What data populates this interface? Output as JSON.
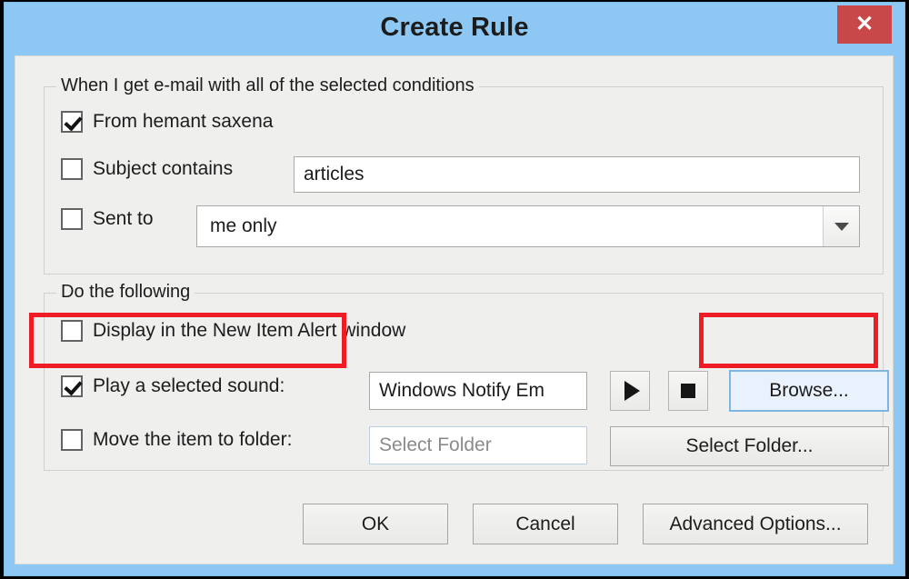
{
  "window": {
    "title": "Create Rule",
    "close_label": "✕",
    "close_icon": "close-icon"
  },
  "conditions": {
    "legend": "When I get e-mail with all of the selected conditions",
    "items": [
      {
        "label": "From hemant saxena",
        "checked": true
      },
      {
        "label": "Subject contains",
        "checked": false,
        "value": "articles"
      },
      {
        "label": "Sent to",
        "checked": false,
        "value": "me only"
      }
    ]
  },
  "actions": {
    "legend": "Do the following",
    "display_alert": {
      "label": "Display in the New Item Alert window",
      "checked": false
    },
    "play_sound": {
      "label": "Play a selected sound:",
      "checked": true,
      "sound_value": "Windows Notify Em",
      "play_icon": "play-icon",
      "stop_icon": "stop-icon",
      "browse_label": "Browse..."
    },
    "move_folder": {
      "label": "Move the item to folder:",
      "checked": false,
      "placeholder": "Select Folder",
      "button_label": "Select Folder..."
    }
  },
  "footer": {
    "ok_label": "OK",
    "cancel_label": "Cancel",
    "advanced_label": "Advanced Options..."
  },
  "colors": {
    "title_bar": "#8dc8f4",
    "close_button": "#c8484a",
    "annotation": "#ee1c25",
    "dialog_bg": "#efefee",
    "focus_border": "#7fb4e3"
  }
}
